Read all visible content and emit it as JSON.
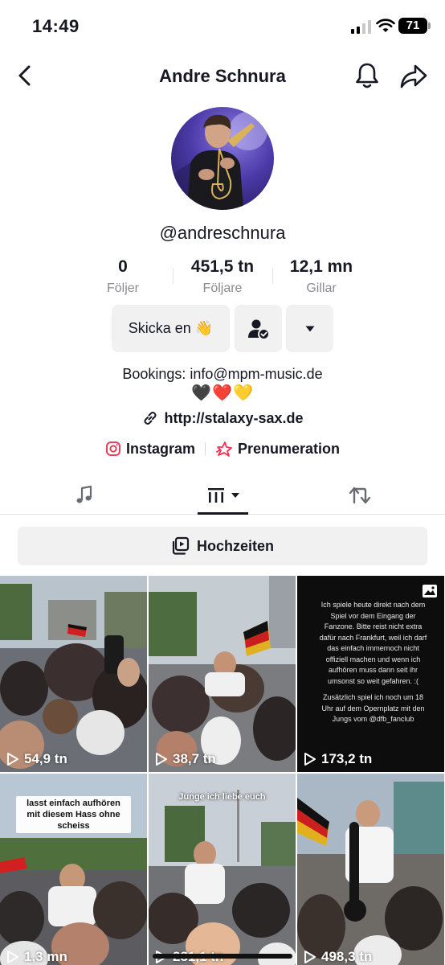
{
  "status_bar": {
    "time": "14:49",
    "battery": "71"
  },
  "header": {
    "title": "Andre Schnura"
  },
  "profile": {
    "username": "@andreschnura",
    "stats": [
      {
        "value": "0",
        "label": "Följer"
      },
      {
        "value": "451,5 tn",
        "label": "Följare"
      },
      {
        "value": "12,1 mn",
        "label": "Gillar"
      }
    ],
    "message_button": "Skicka en 👋",
    "bio_line": "Bookings: info@mpm-music.de",
    "bio_hearts": "🖤❤️💛",
    "link": "http://stalaxy-sax.de",
    "instagram_label": "Instagram",
    "subscription_label": "Prenumeration"
  },
  "playlist": {
    "label": "Hochzeiten"
  },
  "videos": [
    {
      "views": "54,9 tn",
      "caption": ""
    },
    {
      "views": "38,7 tn",
      "caption": ""
    },
    {
      "views": "173,2 tn",
      "caption": "",
      "text": "Ich spiele heute direkt nach dem Spiel vor dem Eingang der Fanzone. Bitte reist nicht extra dafür nach Frankfurt, weil ich darf das einfach immernoch nicht offiziell machen und wenn ich aufhören muss dann seit ihr umsonst so weit gefahren. :(",
      "text2": "Zusätzlich spiel ich noch um 18 Uhr auf dem Opernplatz mit den Jungs vom @dfb_fanclub"
    },
    {
      "views": "1,3 mn",
      "caption": "lasst einfach aufhören mit diesem Hass ohne scheiss"
    },
    {
      "views": "231,1 tn",
      "caption": "Junge ich liebe euch"
    },
    {
      "views": "498,3 tn",
      "caption": ""
    }
  ],
  "icons": {
    "back": "chevron-left-icon",
    "bell": "bell-icon",
    "share": "share-arrow-icon",
    "follow_status": "user-check-icon",
    "more": "caret-down-icon",
    "link": "link-icon",
    "instagram": "instagram-icon",
    "subscription": "subscription-icon",
    "tab_music": "music-note-icon",
    "tab_videos": "videos-grid-icon",
    "tab_reposts": "repost-icon",
    "playlist": "playlist-icon",
    "play": "play-icon",
    "photo": "photo-icon"
  },
  "colors": {
    "text": "#161823",
    "muted": "#8a8b91",
    "button_bg": "#f1f1f2",
    "accent": "#fe2c55"
  }
}
